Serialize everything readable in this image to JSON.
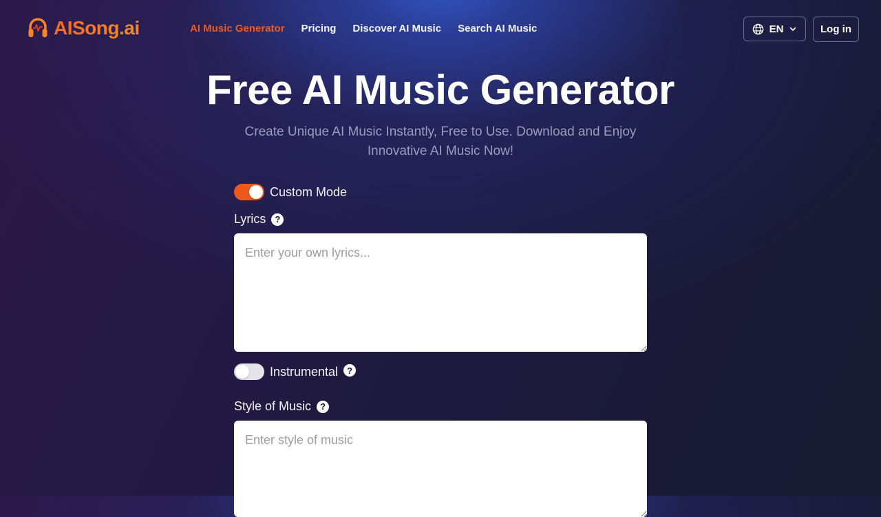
{
  "brand": {
    "name": "AISong.ai",
    "logo_icon": "headphones-pulse-icon",
    "accent_color": "#ea5a24"
  },
  "nav": {
    "links": [
      {
        "label": "AI Music Generator",
        "active": true
      },
      {
        "label": "Pricing",
        "active": false
      },
      {
        "label": "Discover AI Music",
        "active": false
      },
      {
        "label": "Search AI Music",
        "active": false
      }
    ],
    "language": {
      "icon": "globe-icon",
      "value": "EN",
      "chevron": "chevron-down-icon"
    },
    "login_label": "Log in"
  },
  "hero": {
    "title": "Free AI Music Generator",
    "subtitle": "Create Unique AI Music Instantly, Free to Use. Download and Enjoy Innovative AI Music Now!"
  },
  "form": {
    "custom_mode": {
      "label": "Custom Mode",
      "on": true
    },
    "lyrics": {
      "label": "Lyrics",
      "placeholder": "Enter your own lyrics...",
      "value": ""
    },
    "instrumental": {
      "label": "Instrumental",
      "on": false
    },
    "style": {
      "label": "Style of Music",
      "placeholder": "Enter style of music",
      "value": ""
    }
  }
}
